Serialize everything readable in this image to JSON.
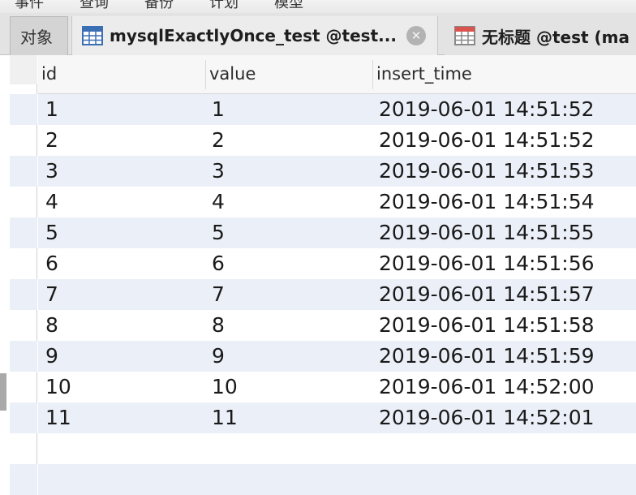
{
  "menu": {
    "items": [
      "事件",
      "查询",
      "备份",
      "计划",
      "模型"
    ]
  },
  "tabs": [
    {
      "label": "对象",
      "kind": "objects"
    },
    {
      "label": "mysqlExactlyOnce_test @test...",
      "kind": "table",
      "active": true
    },
    {
      "label": "无标题 @test (mac",
      "kind": "query"
    }
  ],
  "grid": {
    "columns": [
      "id",
      "value",
      "insert_time"
    ],
    "rows": [
      {
        "id": "1",
        "value": "1",
        "insert_time": "2019-06-01 14:51:52"
      },
      {
        "id": "2",
        "value": "2",
        "insert_time": "2019-06-01 14:51:52"
      },
      {
        "id": "3",
        "value": "3",
        "insert_time": "2019-06-01 14:51:53"
      },
      {
        "id": "4",
        "value": "4",
        "insert_time": "2019-06-01 14:51:54"
      },
      {
        "id": "5",
        "value": "5",
        "insert_time": "2019-06-01 14:51:55"
      },
      {
        "id": "6",
        "value": "6",
        "insert_time": "2019-06-01 14:51:56"
      },
      {
        "id": "7",
        "value": "7",
        "insert_time": "2019-06-01 14:51:57"
      },
      {
        "id": "8",
        "value": "8",
        "insert_time": "2019-06-01 14:51:58"
      },
      {
        "id": "9",
        "value": "9",
        "insert_time": "2019-06-01 14:51:59"
      },
      {
        "id": "10",
        "value": "10",
        "insert_time": "2019-06-01 14:52:00"
      },
      {
        "id": "11",
        "value": "11",
        "insert_time": "2019-06-01 14:52:01"
      }
    ]
  },
  "colors": {
    "alt_row": "#ebeff8",
    "tab_active": "#ececec",
    "table_icon_blue": "#3a6fb6"
  }
}
